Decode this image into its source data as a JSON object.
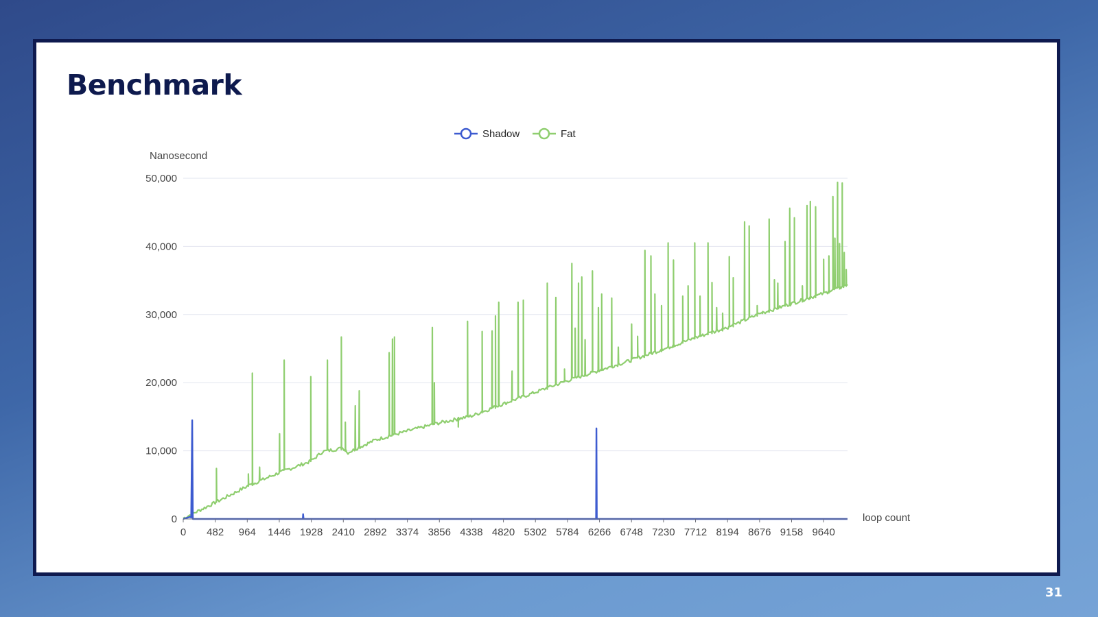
{
  "slide": {
    "title": "Benchmark",
    "page_number": "31"
  },
  "colors": {
    "shadow": "#3d5bd0",
    "fat": "#8fce6f",
    "grid": "#e2e5ef",
    "axis_text": "#454545"
  },
  "chart_data": {
    "type": "line",
    "ylabel": "Nanosecond",
    "xlabel": "loop count",
    "ylim": [
      0,
      50000
    ],
    "yticks": [
      0,
      10000,
      20000,
      30000,
      40000,
      50000
    ],
    "ytick_labels": [
      "0",
      "10,000",
      "20,000",
      "30,000",
      "40,000",
      "50,000"
    ],
    "xlim": [
      0,
      10000
    ],
    "xticks": [
      0,
      482,
      964,
      1446,
      1928,
      2410,
      2892,
      3374,
      3856,
      4338,
      4820,
      5302,
      5784,
      6266,
      6748,
      7230,
      7712,
      8194,
      8676,
      9158,
      9640
    ],
    "grid": true,
    "legend_position": "top-center",
    "series": [
      {
        "name": "Shadow",
        "baseline": [
          [
            0,
            0
          ],
          [
            10000,
            0
          ]
        ],
        "points": [
          [
            0,
            0
          ],
          [
            100,
            300
          ],
          [
            120,
            200
          ],
          [
            135,
            14500
          ],
          [
            145,
            0
          ],
          [
            1800,
            0
          ],
          [
            1805,
            700
          ],
          [
            1812,
            0
          ],
          [
            6215,
            0
          ],
          [
            6220,
            13300
          ],
          [
            6226,
            0
          ],
          [
            10000,
            0
          ]
        ]
      },
      {
        "name": "Fat",
        "baseline": [
          [
            0,
            0
          ],
          [
            482,
            2300
          ],
          [
            964,
            4700
          ],
          [
            1446,
            6700
          ],
          [
            1928,
            8400
          ],
          [
            2100,
            9800
          ],
          [
            2410,
            10300
          ],
          [
            2470,
            9600
          ],
          [
            2892,
            11500
          ],
          [
            3374,
            12800
          ],
          [
            3856,
            14000
          ],
          [
            4338,
            15000
          ],
          [
            4820,
            16800
          ],
          [
            5302,
            18500
          ],
          [
            5784,
            20200
          ],
          [
            6266,
            21700
          ],
          [
            6748,
            23200
          ],
          [
            7230,
            24800
          ],
          [
            7712,
            26500
          ],
          [
            8194,
            28000
          ],
          [
            8676,
            30000
          ],
          [
            9158,
            31500
          ],
          [
            9640,
            33000
          ],
          [
            10000,
            34200
          ]
        ],
        "spikes": [
          [
            500,
            7400
          ],
          [
            980,
            6600
          ],
          [
            1040,
            21400
          ],
          [
            1150,
            7600
          ],
          [
            1450,
            12500
          ],
          [
            1520,
            23300
          ],
          [
            1920,
            20900
          ],
          [
            2170,
            23300
          ],
          [
            2380,
            26700
          ],
          [
            2440,
            14200
          ],
          [
            2590,
            16600
          ],
          [
            2650,
            18800
          ],
          [
            3100,
            24400
          ],
          [
            3150,
            26400
          ],
          [
            3180,
            26700
          ],
          [
            3750,
            28100
          ],
          [
            3780,
            20000
          ],
          [
            4140,
            13500
          ],
          [
            4280,
            29000
          ],
          [
            4500,
            27500
          ],
          [
            4650,
            27600
          ],
          [
            4700,
            29800
          ],
          [
            4750,
            31800
          ],
          [
            4950,
            21700
          ],
          [
            5040,
            31800
          ],
          [
            5120,
            32100
          ],
          [
            5480,
            34600
          ],
          [
            5610,
            32500
          ],
          [
            5740,
            22000
          ],
          [
            5850,
            37500
          ],
          [
            5900,
            28000
          ],
          [
            5950,
            34600
          ],
          [
            6000,
            35500
          ],
          [
            6050,
            26300
          ],
          [
            6160,
            36400
          ],
          [
            6250,
            31000
          ],
          [
            6300,
            33000
          ],
          [
            6450,
            32400
          ],
          [
            6550,
            25200
          ],
          [
            6750,
            28600
          ],
          [
            6840,
            26800
          ],
          [
            6950,
            39400
          ],
          [
            7040,
            38600
          ],
          [
            7100,
            33000
          ],
          [
            7200,
            31300
          ],
          [
            7300,
            40500
          ],
          [
            7380,
            38000
          ],
          [
            7520,
            32700
          ],
          [
            7600,
            34200
          ],
          [
            7700,
            40500
          ],
          [
            7780,
            32700
          ],
          [
            7900,
            40500
          ],
          [
            7960,
            34700
          ],
          [
            8030,
            31000
          ],
          [
            8120,
            30200
          ],
          [
            8220,
            38500
          ],
          [
            8280,
            35400
          ],
          [
            8450,
            43600
          ],
          [
            8520,
            43000
          ],
          [
            8640,
            31300
          ],
          [
            8720,
            30200
          ],
          [
            8820,
            44000
          ],
          [
            8900,
            35100
          ],
          [
            8950,
            34600
          ],
          [
            9060,
            40700
          ],
          [
            9130,
            45600
          ],
          [
            9200,
            44200
          ],
          [
            9320,
            34200
          ],
          [
            9390,
            46000
          ],
          [
            9440,
            46600
          ],
          [
            9520,
            45800
          ],
          [
            9640,
            38100
          ],
          [
            9720,
            38600
          ],
          [
            9780,
            47300
          ],
          [
            9810,
            41200
          ],
          [
            9850,
            49400
          ],
          [
            9880,
            40400
          ],
          [
            9920,
            49300
          ],
          [
            9950,
            39100
          ],
          [
            9980,
            36600
          ]
        ]
      }
    ]
  }
}
